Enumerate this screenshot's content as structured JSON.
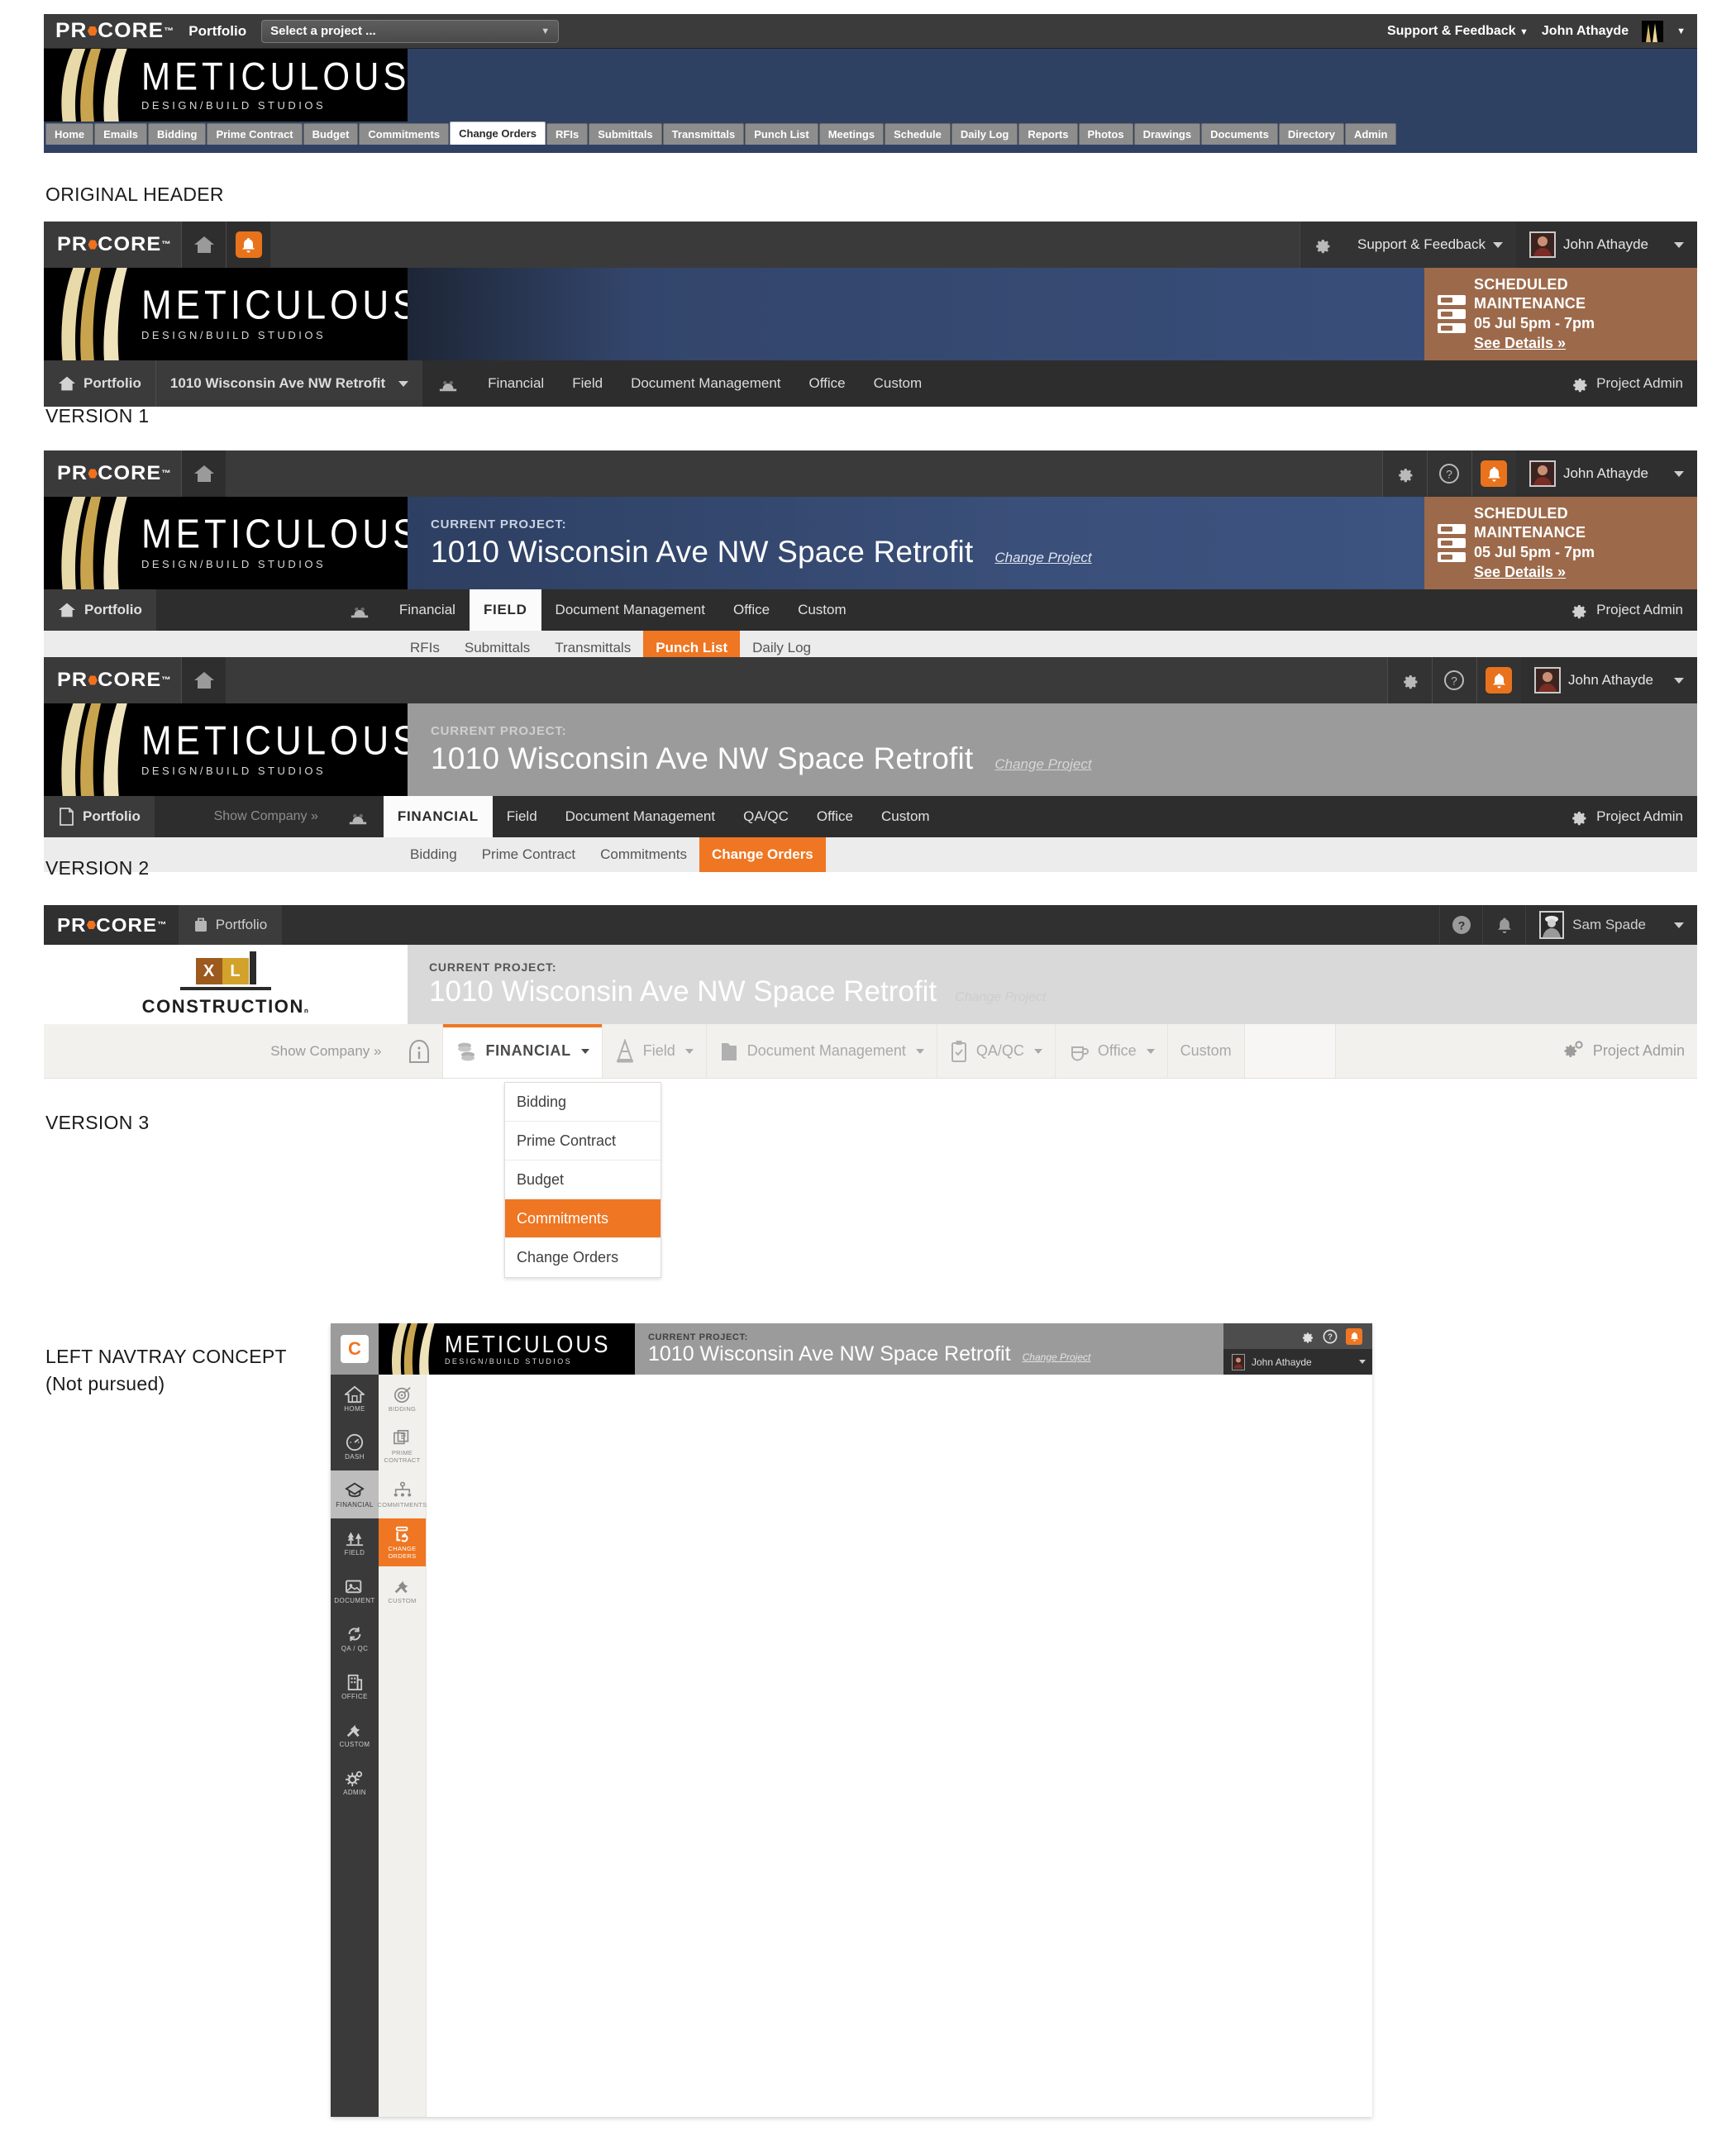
{
  "labels": {
    "original_header": "ORIGINAL HEADER",
    "version1": "VERSION 1",
    "version2": "VERSION 2",
    "version3": "VERSION 3",
    "navtray_line1": "LEFT NAVTRAY CONCEPT",
    "navtray_line2": "(Not pursued)"
  },
  "brand": {
    "procore": "PROCORE",
    "trademark": "™",
    "accent": "#ef7622",
    "bell_orange": "#e8731c",
    "blue_band": "#33456b",
    "maintenance_brown": "#9c6a4b"
  },
  "logo": {
    "name": "METICULOUS",
    "subtitle": "DESIGN/BUILD STUDIOS"
  },
  "xl_logo": {
    "x": "X",
    "l": "L",
    "name": "CONSTRUCTION",
    "tm": "ₙ"
  },
  "original_header": {
    "portfolio": "Portfolio",
    "project_select_placeholder": "Select a project ...",
    "support": "Support & Feedback",
    "user": "John Athayde",
    "tabs": [
      {
        "label": "Home",
        "active": false
      },
      {
        "label": "Emails",
        "active": false
      },
      {
        "label": "Bidding",
        "active": false
      },
      {
        "label": "Prime Contract",
        "active": false
      },
      {
        "label": "Budget",
        "active": false
      },
      {
        "label": "Commitments",
        "active": false
      },
      {
        "label": "Change Orders",
        "active": true
      },
      {
        "label": "RFIs",
        "active": false
      },
      {
        "label": "Submittals",
        "active": false
      },
      {
        "label": "Transmittals",
        "active": false
      },
      {
        "label": "Punch List",
        "active": false
      },
      {
        "label": "Meetings",
        "active": false
      },
      {
        "label": "Schedule",
        "active": false
      },
      {
        "label": "Daily Log",
        "active": false
      },
      {
        "label": "Reports",
        "active": false
      },
      {
        "label": "Photos",
        "active": false
      },
      {
        "label": "Drawings",
        "active": false
      },
      {
        "label": "Documents",
        "active": false
      },
      {
        "label": "Directory",
        "active": false
      },
      {
        "label": "Admin",
        "active": false
      }
    ]
  },
  "maintenance": {
    "title": "SCHEDULED MAINTENANCE",
    "date": "05 Jul  5pm - 7pm",
    "link": "See Details »"
  },
  "version1": {
    "support": "Support & Feedback",
    "user": "John Athayde",
    "portfolio": "Portfolio",
    "project": "1010 Wisconsin Ave NW Retrofit",
    "nav": [
      "Financial",
      "Field",
      "Document Management",
      "Office",
      "Custom"
    ],
    "project_admin": "Project Admin"
  },
  "version2a": {
    "user": "John Athayde",
    "portfolio": "Portfolio",
    "current_project_label": "CURRENT PROJECT:",
    "project": "1010 Wisconsin Ave NW Space Retrofit",
    "change_project": "Change Project",
    "nav": [
      {
        "label": "Financial",
        "active": false
      },
      {
        "label": "FIELD",
        "active": true
      },
      {
        "label": "Document Management",
        "active": false
      },
      {
        "label": "Office",
        "active": false
      },
      {
        "label": "Custom",
        "active": false
      }
    ],
    "subnav": [
      {
        "label": "RFIs",
        "active": false
      },
      {
        "label": "Submittals",
        "active": false
      },
      {
        "label": "Transmittals",
        "active": false
      },
      {
        "label": "Punch List",
        "active": true
      },
      {
        "label": "Daily Log",
        "active": false
      }
    ],
    "project_admin": "Project Admin"
  },
  "version2b": {
    "user": "John Athayde",
    "portfolio": "Portfolio",
    "show_company": "Show Company »",
    "current_project_label": "CURRENT PROJECT:",
    "project": "1010 Wisconsin Ave NW Space Retrofit",
    "change_project": "Change Project",
    "nav": [
      {
        "label": "FINANCIAL",
        "active": true
      },
      {
        "label": "Field",
        "active": false
      },
      {
        "label": "Document Management",
        "active": false
      },
      {
        "label": "QA/QC",
        "active": false
      },
      {
        "label": "Office",
        "active": false
      },
      {
        "label": "Custom",
        "active": false
      }
    ],
    "subnav": [
      {
        "label": "Bidding",
        "active": false
      },
      {
        "label": "Prime Contract",
        "active": false
      },
      {
        "label": "Commitments",
        "active": false
      },
      {
        "label": "Change Orders",
        "active": true
      }
    ],
    "project_admin": "Project Admin"
  },
  "version3": {
    "portfolio": "Portfolio",
    "user": "Sam Spade",
    "current_project_label": "CURRENT PROJECT:",
    "project": "1010 Wisconsin Ave NW Space Retrofit",
    "change_project": "Change Project",
    "show_company": "Show Company »",
    "nav": [
      {
        "label": "FINANCIAL",
        "active": true,
        "caret": true
      },
      {
        "label": "Field",
        "active": false,
        "caret": true
      },
      {
        "label": "Document Management",
        "active": false,
        "caret": true
      },
      {
        "label": "QA/QC",
        "active": false,
        "caret": true
      },
      {
        "label": "Office",
        "active": false,
        "caret": true
      },
      {
        "label": "Custom",
        "active": false,
        "caret": false
      }
    ],
    "project_admin": "Project Admin",
    "dropdown": [
      {
        "label": "Bidding",
        "active": false
      },
      {
        "label": "Prime Contract",
        "active": false
      },
      {
        "label": "Budget",
        "active": false
      },
      {
        "label": "Commitments",
        "active": true
      },
      {
        "label": "Change Orders",
        "active": false
      }
    ]
  },
  "navtray": {
    "current_project_label": "CURRENT PROJECT:",
    "project": "1010 Wisconsin Ave NW Space Retrofit",
    "change_project": "Change Project",
    "user": "John Athayde",
    "rail": [
      {
        "label": "HOME",
        "sel": false
      },
      {
        "label": "DASH",
        "sel": false
      },
      {
        "label": "FINANCIAL",
        "sel": true
      },
      {
        "label": "FIELD",
        "sel": false
      },
      {
        "label": "DOCUMENT",
        "sel": false
      },
      {
        "label": "QA / QC",
        "sel": false
      },
      {
        "label": "OFFICE",
        "sel": false
      },
      {
        "label": "CUSTOM",
        "sel": false
      },
      {
        "label": "ADMIN",
        "sel": false
      }
    ],
    "sub": [
      {
        "label": "BIDDING",
        "on": false
      },
      {
        "label": "PRIME CONTRACT",
        "on": false
      },
      {
        "label": "COMMITMENTS",
        "on": false
      },
      {
        "label": "CHANGE ORDERS",
        "on": true
      },
      {
        "label": "CUSTOM",
        "on": false
      }
    ]
  }
}
